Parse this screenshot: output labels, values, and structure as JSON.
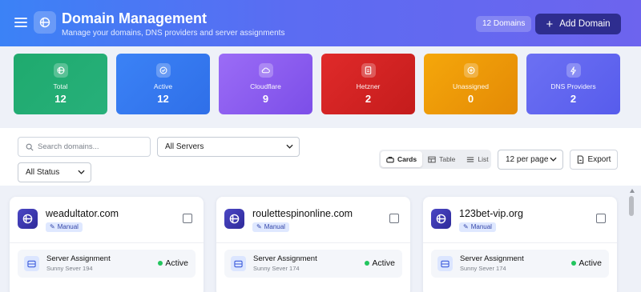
{
  "header": {
    "title": "Domain Management",
    "subtitle": "Manage your domains, DNS providers and server assignments",
    "count_badge": "12 Domains",
    "add_button": "Add Domain"
  },
  "stats": [
    {
      "label": "Total",
      "value": "12",
      "icon": "domain-icon",
      "color": "#22a06b"
    },
    {
      "label": "Active",
      "value": "12",
      "icon": "check-circle-icon",
      "color": "#3b82f6"
    },
    {
      "label": "Cloudflare",
      "value": "9",
      "icon": "cloud-icon",
      "color": "#8b5cf6"
    },
    {
      "label": "Hetzner",
      "value": "2",
      "icon": "document-icon",
      "color": "#dc2626"
    },
    {
      "label": "Unassigned",
      "value": "0",
      "icon": "plus-circle-icon",
      "color": "#f59e0b"
    },
    {
      "label": "DNS Providers",
      "value": "2",
      "icon": "bolt-icon",
      "color": "#6366f1"
    }
  ],
  "toolbar": {
    "search_placeholder": "Search domains...",
    "server_filter": "All Servers",
    "status_filter": "All Status",
    "views": [
      "Cards",
      "Table",
      "List"
    ],
    "active_view": "Cards",
    "per_page": "12 per page",
    "export": "Export"
  },
  "domains": [
    {
      "name": "weadultator.com",
      "badge": "Manual",
      "server_title": "Server Assignment",
      "server_name": "Sunny Sever 194",
      "status": "Active"
    },
    {
      "name": "roulettespinonline.com",
      "badge": "Manual",
      "server_title": "Server Assignment",
      "server_name": "Sunny Sever 174",
      "status": "Active"
    },
    {
      "name": "123bet-vip.org",
      "badge": "Manual",
      "server_title": "Server Assignment",
      "server_name": "Sunny Sever 174",
      "status": "Active"
    }
  ]
}
